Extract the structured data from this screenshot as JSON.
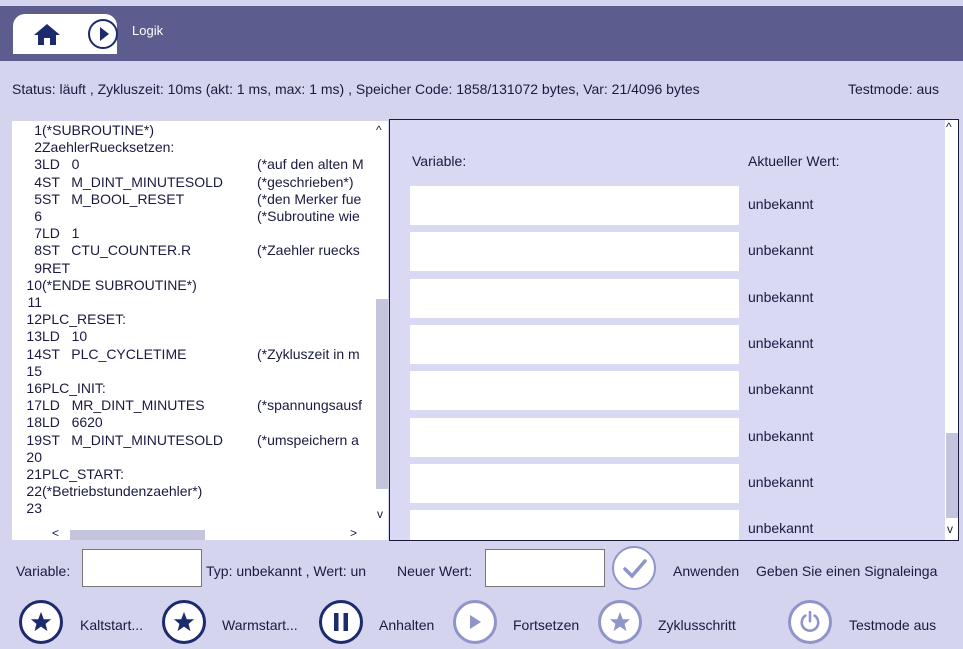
{
  "header": {
    "title": "Logik"
  },
  "status": {
    "text": "Status: läuft , Zykluszeit: 10ms (akt: 1 ms, max: 1 ms) , Speicher Code: 1858/131072 bytes, Var: 21/4096 bytes",
    "testmode": "Testmode: aus"
  },
  "code_lines": [
    {
      "n": "1",
      "a": "(*SUBROUTINE*)",
      "b": ""
    },
    {
      "n": "2",
      "a": "ZaehlerRuecksetzen:",
      "b": ""
    },
    {
      "n": "3",
      "a": "LD   0",
      "b": "(*auf den alten M"
    },
    {
      "n": "4",
      "a": "ST   M_DINT_MINUTESOLD",
      "b": "(*geschrieben*)"
    },
    {
      "n": "5",
      "a": "ST   M_BOOL_RESET",
      "b": "(*den Merker fue"
    },
    {
      "n": "6",
      "a": "",
      "b": "(*Subroutine wie"
    },
    {
      "n": "7",
      "a": "LD   1",
      "b": ""
    },
    {
      "n": "8",
      "a": "ST   CTU_COUNTER.R",
      "b": "(*Zaehler ruecks"
    },
    {
      "n": "9",
      "a": "RET",
      "b": ""
    },
    {
      "n": "10",
      "a": "(*ENDE SUBROUTINE*)",
      "b": ""
    },
    {
      "n": "11",
      "a": "",
      "b": ""
    },
    {
      "n": "12",
      "a": "PLC_RESET:",
      "b": ""
    },
    {
      "n": "13",
      "a": "LD   10",
      "b": ""
    },
    {
      "n": "14",
      "a": "ST   PLC_CYCLETIME",
      "b": "(*Zykluszeit in m"
    },
    {
      "n": "15",
      "a": "",
      "b": ""
    },
    {
      "n": "16",
      "a": "PLC_INIT:",
      "b": ""
    },
    {
      "n": "17",
      "a": "LD   MR_DINT_MINUTES",
      "b": "(*spannungsausf"
    },
    {
      "n": "18",
      "a": "LD   6620",
      "b": ""
    },
    {
      "n": "19",
      "a": "ST   M_DINT_MINUTESOLD",
      "b": "(*umspeichern a"
    },
    {
      "n": "20",
      "a": "",
      "b": ""
    },
    {
      "n": "21",
      "a": "PLC_START:",
      "b": ""
    },
    {
      "n": "22",
      "a": "(*Betriebstundenzaehler*)",
      "b": ""
    },
    {
      "n": "23",
      "a": "",
      "b": ""
    }
  ],
  "watch": {
    "header_variable": "Variable:",
    "header_value": "Aktueller Wert:",
    "rows": [
      {
        "value": "unbekannt"
      },
      {
        "value": "unbekannt"
      },
      {
        "value": "unbekannt"
      },
      {
        "value": "unbekannt"
      },
      {
        "value": "unbekannt"
      },
      {
        "value": "unbekannt"
      },
      {
        "value": "unbekannt"
      },
      {
        "value": "unbekannt"
      }
    ]
  },
  "edit": {
    "variable_label": "Variable:",
    "type_text": "Typ: unbekannt , Wert: un",
    "new_value_label": "Neuer Wert:",
    "apply_label": "Anwenden",
    "hint": "Geben Sie einen Signaleinga"
  },
  "buttons": {
    "kaltstart": "Kaltstart...",
    "warmstart": "Warmstart...",
    "anhalten": "Anhalten",
    "fortsetzen": "Fortsetzen",
    "zyklusschritt": "Zyklusschritt",
    "testmode": "Testmode aus"
  },
  "colors": {
    "header_bg": "#5c5c8e",
    "page_bg": "#d4d4ee",
    "icon_dark": "#1c2a6e",
    "icon_light": "#8f95c8"
  }
}
